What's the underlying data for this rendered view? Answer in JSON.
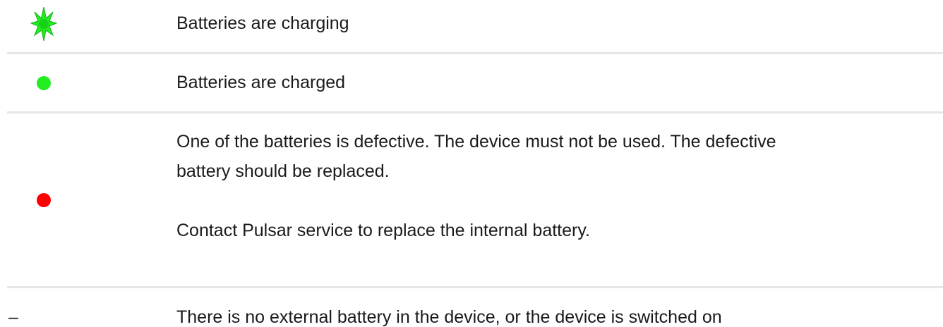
{
  "rows": [
    {
      "indicator": {
        "icon": "blinking-green-led-icon",
        "color": "#22ee22"
      },
      "description": "Batteries are charging"
    },
    {
      "indicator": {
        "icon": "green-led-icon",
        "color": "#22ee22"
      },
      "description": "Batteries are charged"
    },
    {
      "indicator": {
        "icon": "red-led-icon",
        "color": "#ff0000"
      },
      "description_lines": [
        "One of the batteries is defective. The device must not be used. The defective",
        "battery should be replaced."
      ],
      "note": "Contact Pulsar service to replace the internal battery."
    },
    {
      "indicator": {
        "text": "–"
      },
      "description": "There is no external battery in the device, or the device is switched on"
    }
  ]
}
